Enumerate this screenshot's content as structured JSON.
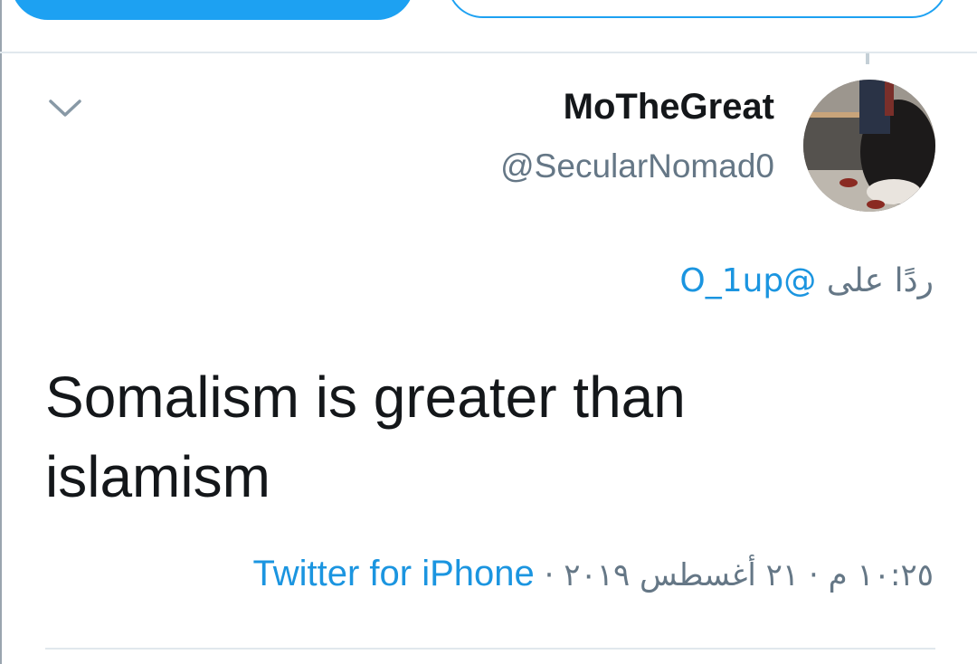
{
  "tweet": {
    "author": {
      "display_name": "MoTheGreat",
      "handle": "@SecularNomad0"
    },
    "reply_context": {
      "prefix": "ردًا على",
      "mention": "@O_1up"
    },
    "text_lines": [
      "Somalism is greater than",
      "islamism"
    ],
    "timestamp": "١٠:٢٥ م · ٢١ أغسطس ٢٠١٩",
    "separator": "·",
    "source": "Twitter for iPhone"
  },
  "colors": {
    "accent": "#1da1f2",
    "link": "#1b95e0",
    "secondary_text": "#657786",
    "primary_text": "#14171a",
    "divider": "#e1e8ed"
  },
  "icons": {
    "menu": "chevron-down-icon"
  }
}
